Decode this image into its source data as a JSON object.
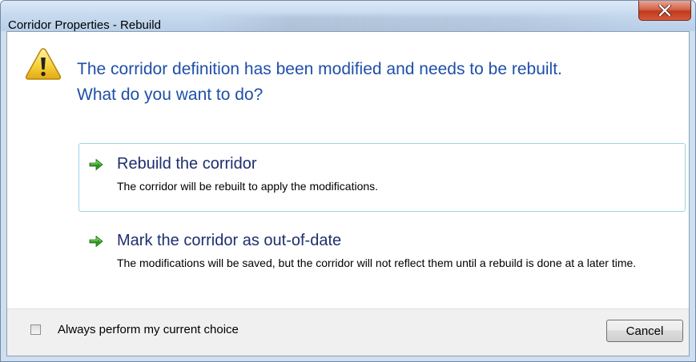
{
  "window": {
    "title": "Corridor Properties - Rebuild"
  },
  "icons": {
    "warning": "warning-icon",
    "close": "close-icon",
    "arrow": "green-arrow-icon"
  },
  "instruction": {
    "line1": "The corridor definition has been modified and needs to be rebuilt.",
    "line2": "What do you want to do?"
  },
  "options": [
    {
      "title": "Rebuild the corridor",
      "description": "The corridor will be rebuilt to apply the modifications.",
      "highlighted": true
    },
    {
      "title": "Mark the corridor as out-of-date",
      "description": "The modifications will be saved, but the corridor will not reflect them until a rebuild is done at a later time.",
      "highlighted": false
    }
  ],
  "footer": {
    "checkbox_label": "Always perform my current choice",
    "checkbox_checked": false,
    "cancel_label": "Cancel"
  },
  "colors": {
    "instruction_text": "#1f4fa8",
    "command_title": "#1e2f6d",
    "hover_border": "#9bd3ea",
    "close_button": "#c1391b",
    "arrow_green": "#2e9b1f"
  }
}
